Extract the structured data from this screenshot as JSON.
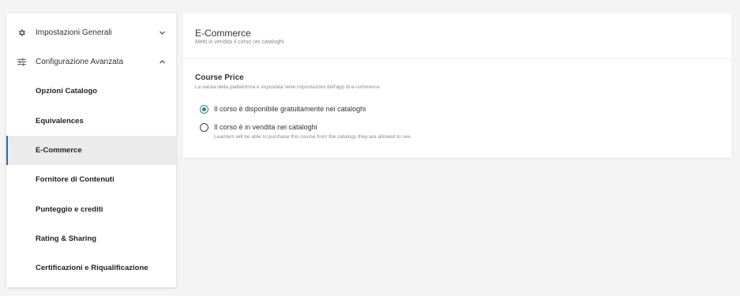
{
  "sidebar": {
    "sections": [
      {
        "label": "Impostazioni Generali",
        "icon": "gear-icon",
        "chevron": "chevron-down-icon"
      },
      {
        "label": "Configurazione Avanzata",
        "icon": "sliders-icon",
        "chevron": "chevron-up-icon"
      }
    ],
    "items": [
      {
        "label": "Opzioni Catalogo"
      },
      {
        "label": "Equivalences"
      },
      {
        "label": "E-Commerce",
        "active": true
      },
      {
        "label": "Fornitore di Contenuti"
      },
      {
        "label": "Punteggio e crediti"
      },
      {
        "label": "Rating & Sharing"
      },
      {
        "label": "Certificazioni e Riqualificazione"
      }
    ]
  },
  "main": {
    "title": "E-Commerce",
    "subtitle": "Metti in vendita il corso nei cataloghi",
    "course_price": {
      "title": "Course Price",
      "subtitle": "La valuta della piattaforma è impostata nelle impostazioni dell'app di e-commerce",
      "options": [
        {
          "label": "Il corso è disponibile gratuitamente nei cataloghi",
          "checked": true,
          "description": ""
        },
        {
          "label": "Il corso è in vendita nei cataloghi",
          "checked": false,
          "description": "Learners will be able to purchase this course from the catalogs they are allowed to see"
        }
      ]
    }
  },
  "colors": {
    "accent": "#2f8a86",
    "active_border": "#2d6fa3",
    "active_bg": "#ebebeb",
    "page_bg": "#f4f4f4"
  }
}
